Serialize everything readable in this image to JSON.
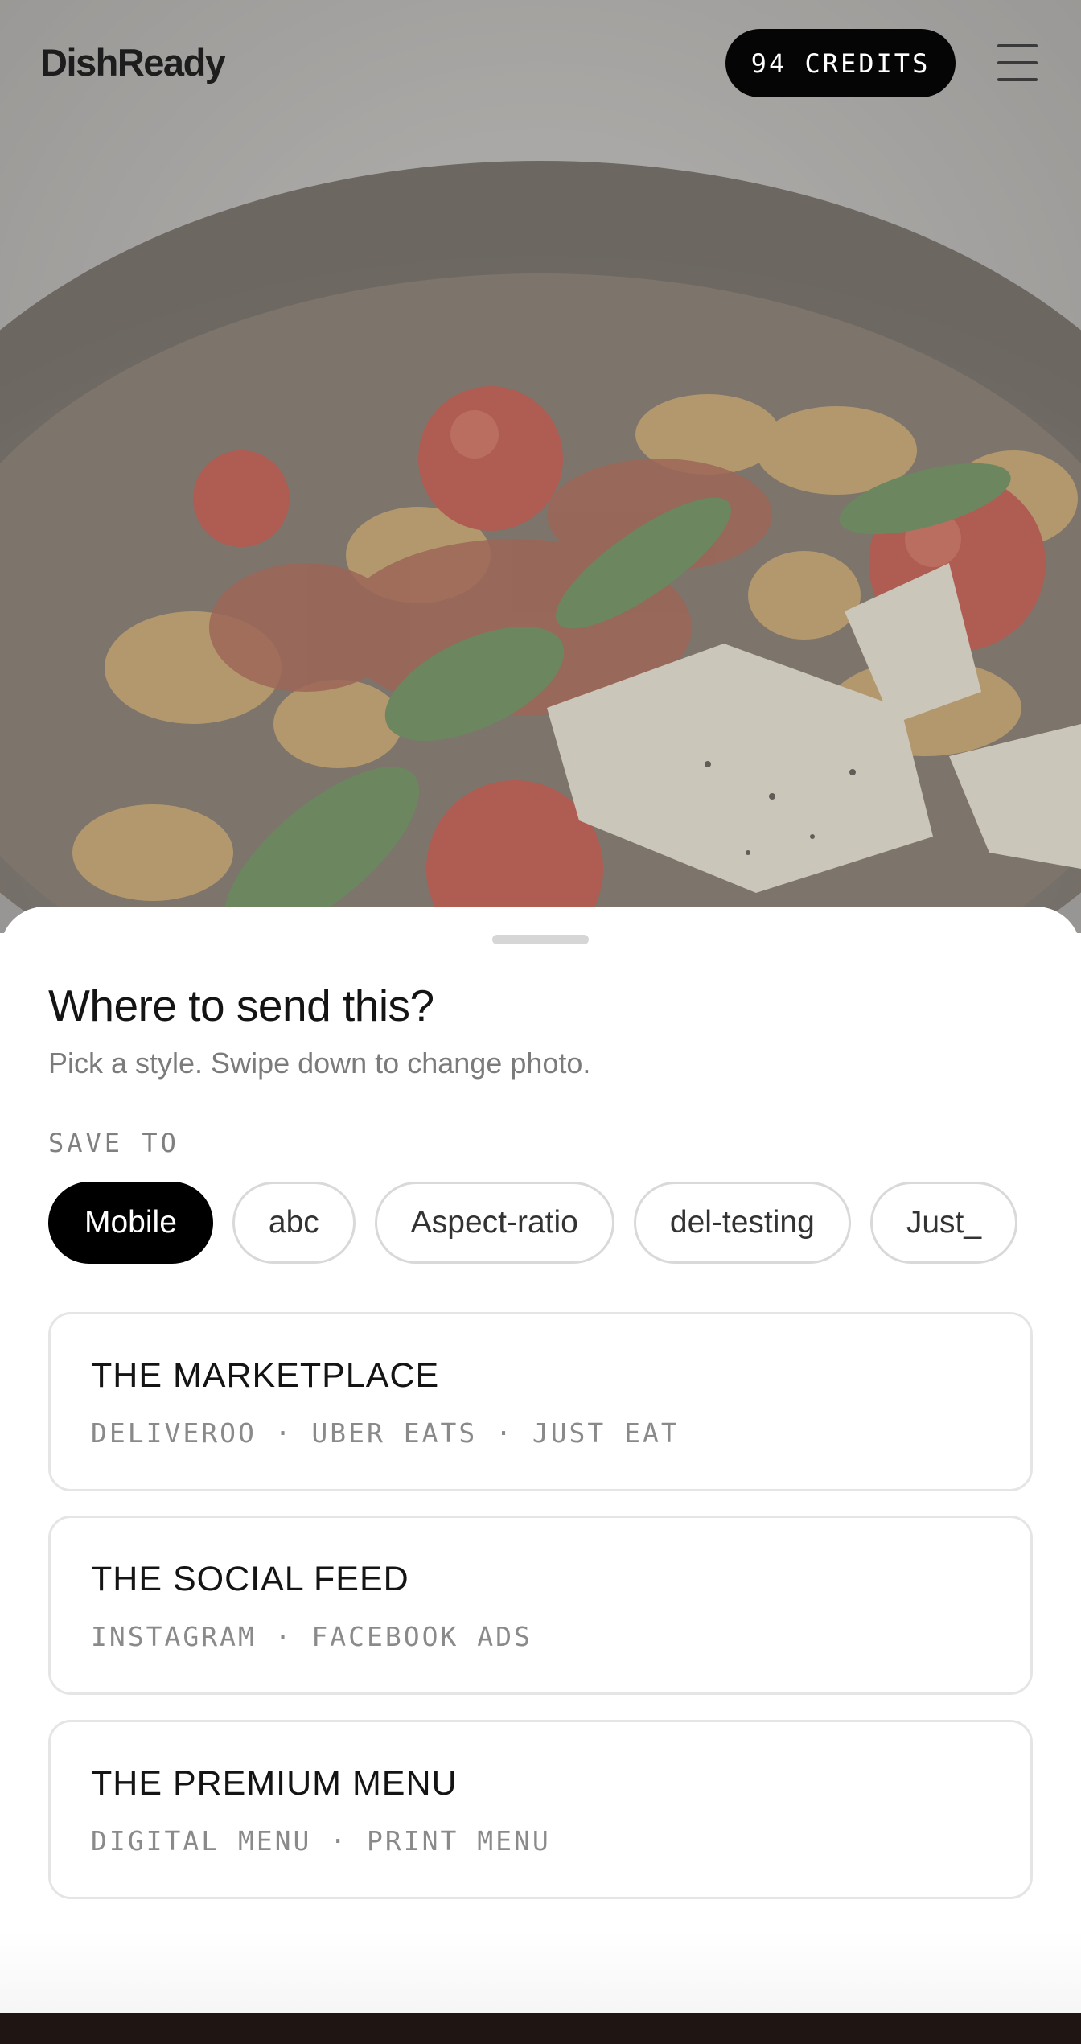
{
  "app": {
    "brand": "DishReady",
    "credits_label": "94 CREDITS",
    "menu_icon": "hamburger-menu-icon"
  },
  "hero": {
    "description_icon": "food-photo",
    "dimmed": true
  },
  "sheet": {
    "title": "Where to send this?",
    "subtitle": "Pick a style. Swipe down to change photo.",
    "save_to_label": "SAVE TO",
    "folders": [
      {
        "label": "Mobile",
        "selected": true
      },
      {
        "label": "abc",
        "selected": false
      },
      {
        "label": "Aspect-ratio",
        "selected": false
      },
      {
        "label": "del-testing",
        "selected": false
      },
      {
        "label": "Just_",
        "selected": false
      }
    ],
    "styles": [
      {
        "title": "THE MARKETPLACE",
        "platforms": "DELIVEROO · UBER EATS · JUST EAT"
      },
      {
        "title": "THE SOCIAL FEED",
        "platforms": "INSTAGRAM · FACEBOOK ADS"
      },
      {
        "title": "THE PREMIUM MENU",
        "platforms": "DIGITAL MENU · PRINT MENU"
      }
    ]
  },
  "colors": {
    "accent": "#000000",
    "chip_border": "#d9d9d9",
    "card_border": "#e5e5e5",
    "muted_text": "#8a8a8a"
  }
}
